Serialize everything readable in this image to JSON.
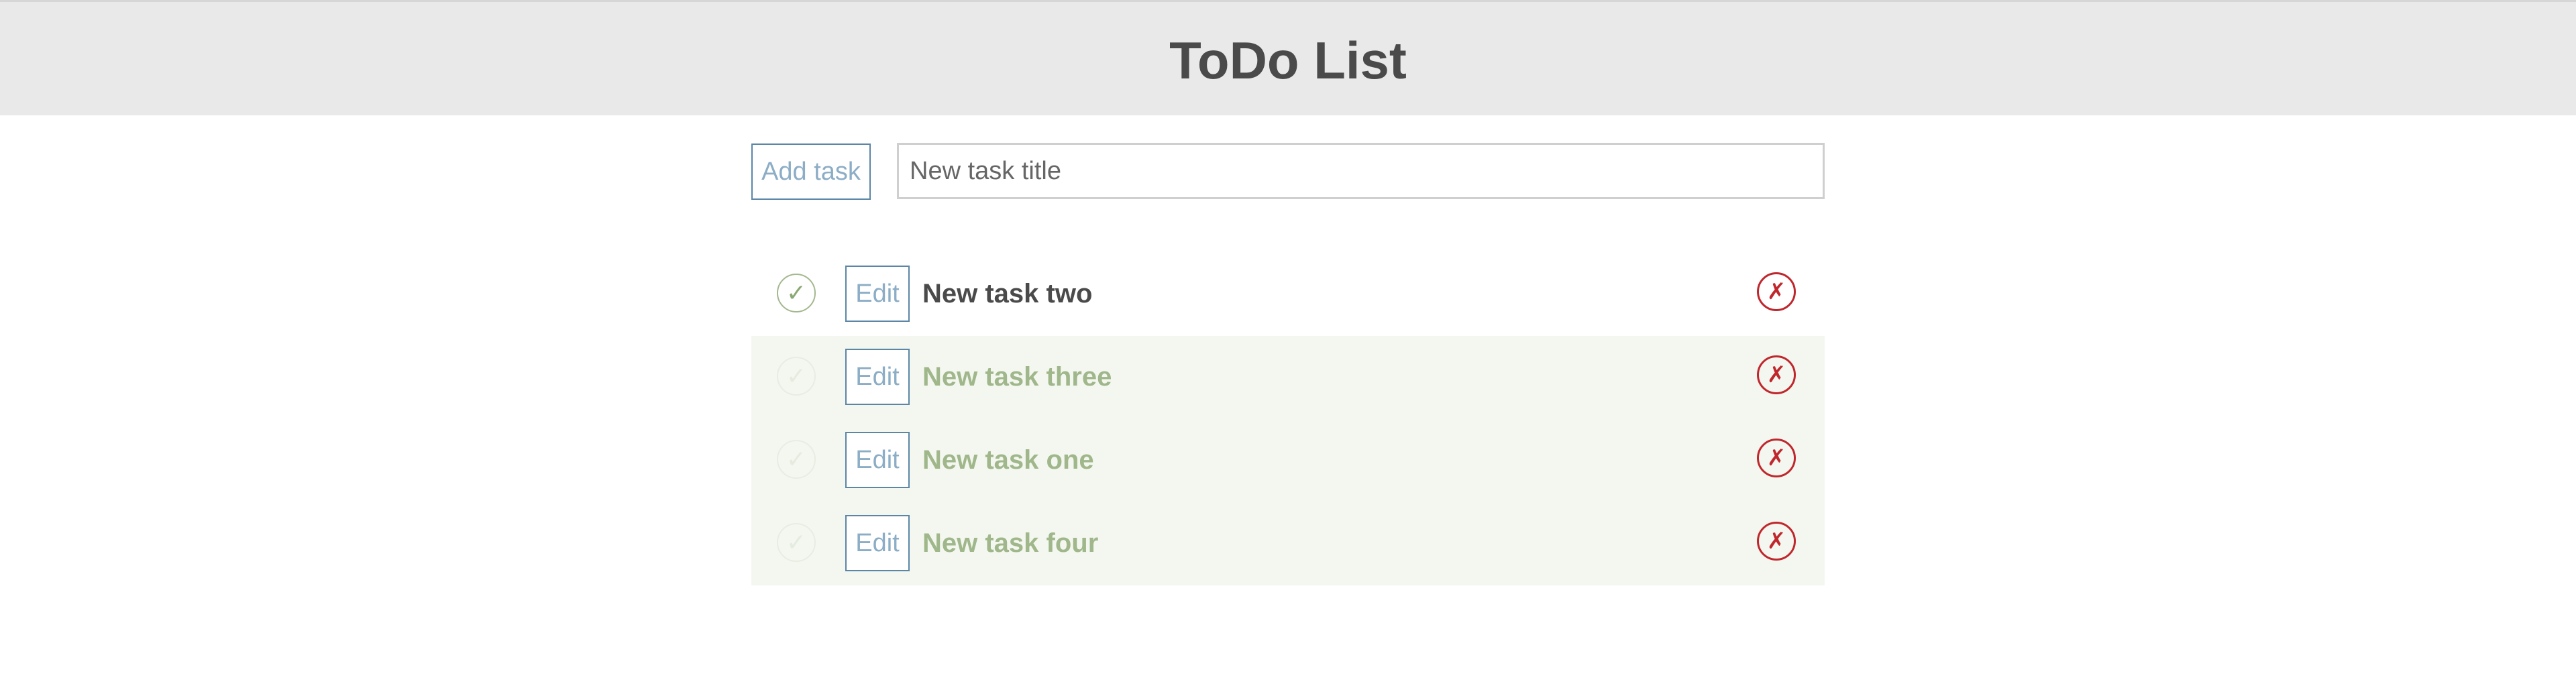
{
  "header": {
    "title": "ToDo List"
  },
  "add_form": {
    "button_label": "Add task",
    "input_placeholder": "New task title",
    "input_value": ""
  },
  "tasks": [
    {
      "title": "New task two",
      "completed": false,
      "edit_label": "Edit",
      "check_glyph": "✓",
      "delete_glyph": "✗"
    },
    {
      "title": "New task three",
      "completed": true,
      "edit_label": "Edit",
      "check_glyph": "✓",
      "delete_glyph": "✗"
    },
    {
      "title": "New task one",
      "completed": true,
      "edit_label": "Edit",
      "check_glyph": "✓",
      "delete_glyph": "✗"
    },
    {
      "title": "New task four",
      "completed": true,
      "edit_label": "Edit",
      "check_glyph": "✓",
      "delete_glyph": "✗"
    }
  ],
  "icons": {
    "check": "check-icon",
    "delete": "delete-icon"
  },
  "colors": {
    "header_bg": "#e9e9e9",
    "accent_blue": "#5b86a6",
    "completed_row_bg": "#f4f7f0",
    "completed_text": "#9fb78a",
    "delete_red": "#c0272d"
  }
}
